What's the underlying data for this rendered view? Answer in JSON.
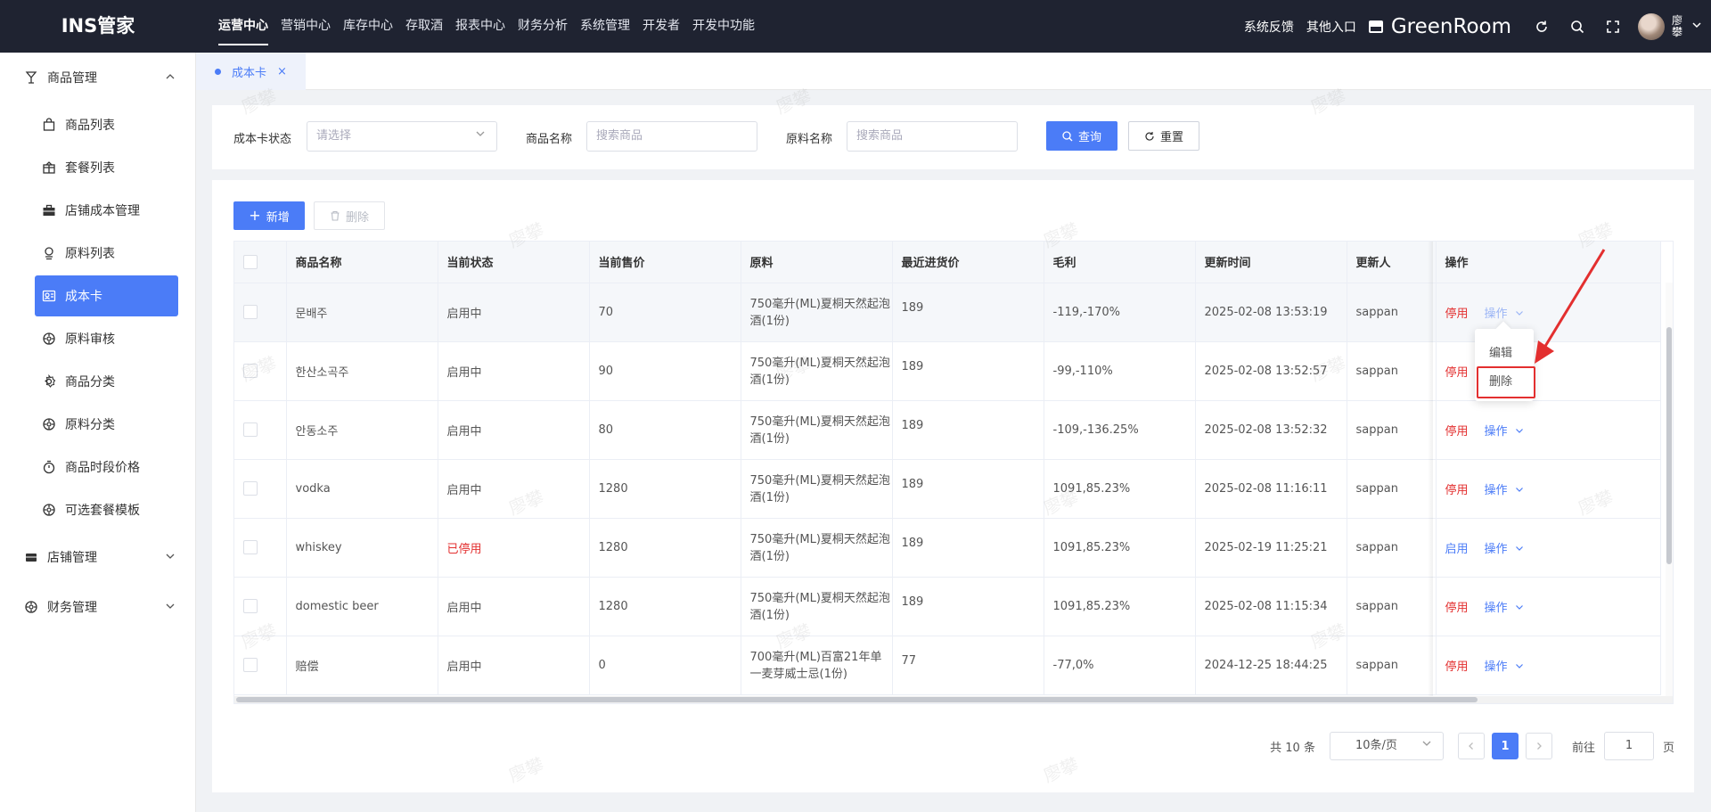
{
  "app": {
    "logo": "INS管家"
  },
  "topnav": {
    "items": [
      {
        "label": "运营中心",
        "active": true
      },
      {
        "label": "营销中心"
      },
      {
        "label": "库存中心"
      },
      {
        "label": "存取酒"
      },
      {
        "label": "报表中心"
      },
      {
        "label": "财务分析"
      },
      {
        "label": "系统管理"
      },
      {
        "label": "开发者"
      },
      {
        "label": "开发中功能"
      }
    ]
  },
  "topright": {
    "feedback": "系统反馈",
    "other_entry": "其他入口",
    "store_name": "GreenRoom",
    "user_name": "廖攀",
    "icons": [
      "refresh-icon",
      "search-icon",
      "fullscreen-icon",
      "chevron-down-icon"
    ]
  },
  "sidebar": {
    "groups": [
      {
        "label": "商品管理",
        "icon": "goblet-icon",
        "expanded": true
      },
      {
        "label": "店铺管理",
        "icon": "store-icon",
        "expanded": false
      },
      {
        "label": "财务管理",
        "icon": "finance-icon",
        "expanded": false
      }
    ],
    "items": [
      {
        "label": "商品列表",
        "icon": "bag-icon"
      },
      {
        "label": "套餐列表",
        "icon": "package-icon"
      },
      {
        "label": "店铺成本管理",
        "icon": "briefcase-icon"
      },
      {
        "label": "原料列表",
        "icon": "materials-icon"
      },
      {
        "label": "成本卡",
        "icon": "card-icon",
        "active": true
      },
      {
        "label": "原料审核",
        "icon": "audit-icon"
      },
      {
        "label": "商品分类",
        "icon": "settings-icon"
      },
      {
        "label": "原料分类",
        "icon": "category-icon"
      },
      {
        "label": "商品时段价格",
        "icon": "timer-icon"
      },
      {
        "label": "可选套餐模板",
        "icon": "template-icon"
      }
    ]
  },
  "tabs": [
    {
      "label": "成本卡",
      "close": "×"
    }
  ],
  "filter": {
    "status_label": "成本卡状态",
    "status_placeholder": "请选择",
    "product_label": "商品名称",
    "product_placeholder": "搜索商品",
    "material_label": "原料名称",
    "material_placeholder": "搜索商品",
    "query_button": "查询",
    "reset_button": "重置"
  },
  "toolbar": {
    "add_button": "新增",
    "delete_button": "删除"
  },
  "table": {
    "columns": [
      "商品名称",
      "当前状态",
      "当前售价",
      "原料",
      "最近进货价",
      "毛利",
      "更新时间",
      "更新人",
      "操作"
    ],
    "rows": [
      {
        "name": "문배주",
        "status": "启用中",
        "price": "70",
        "material": "750毫升(ML)夏桐天然起泡酒(1份)",
        "cost": "189",
        "profit": "-119,-170%",
        "updated": "2025-02-08 13:53:19",
        "updater": "sappan",
        "toggle": "停用",
        "op": "操作",
        "stopped": false
      },
      {
        "name": "한산소곡주",
        "status": "启用中",
        "price": "90",
        "material": "750毫升(ML)夏桐天然起泡酒(1份)",
        "cost": "189",
        "profit": "-99,-110%",
        "updated": "2025-02-08 13:52:57",
        "updater": "sappan",
        "toggle": "停用",
        "op": "操作",
        "stopped": false
      },
      {
        "name": "안동소주",
        "status": "启用中",
        "price": "80",
        "material": "750毫升(ML)夏桐天然起泡酒(1份)",
        "cost": "189",
        "profit": "-109,-136.25%",
        "updated": "2025-02-08 13:52:32",
        "updater": "sappan",
        "toggle": "停用",
        "op": "操作",
        "stopped": false
      },
      {
        "name": "vodka",
        "status": "启用中",
        "price": "1280",
        "material": "750毫升(ML)夏桐天然起泡酒(1份)",
        "cost": "189",
        "profit": "1091,85.23%",
        "updated": "2025-02-08 11:16:11",
        "updater": "sappan",
        "toggle": "停用",
        "op": "操作",
        "stopped": false
      },
      {
        "name": "whiskey",
        "status": "已停用",
        "price": "1280",
        "material": "750毫升(ML)夏桐天然起泡酒(1份)",
        "cost": "189",
        "profit": "1091,85.23%",
        "updated": "2025-02-19 11:25:21",
        "updater": "sappan",
        "toggle": "启用",
        "op": "操作",
        "stopped": true
      },
      {
        "name": "domestic beer",
        "status": "启用中",
        "price": "1280",
        "material": "750毫升(ML)夏桐天然起泡酒(1份)",
        "cost": "189",
        "profit": "1091,85.23%",
        "updated": "2025-02-08 11:15:34",
        "updater": "sappan",
        "toggle": "停用",
        "op": "操作",
        "stopped": false
      },
      {
        "name": "赔偿",
        "status": "启用中",
        "price": "0",
        "material": "700毫升(ML)百富21年单一麦芽威士忌(1份)",
        "cost": "77",
        "profit": "-77,0%",
        "updated": "2024-12-25 18:44:25",
        "updater": "sappan",
        "toggle": "停用",
        "op": "操作",
        "stopped": false
      }
    ]
  },
  "dropdown": {
    "items": [
      "编辑",
      "删除"
    ]
  },
  "pagination": {
    "total": "共 10 条",
    "page_size": "10条/页",
    "current": "1",
    "goto_label": "前往",
    "goto_value": "1",
    "page_suffix": "页"
  },
  "watermark": "廖攀",
  "colors": {
    "primary": "#4b7cf7",
    "danger": "#e32f2f",
    "topbar": "#1f2331"
  }
}
